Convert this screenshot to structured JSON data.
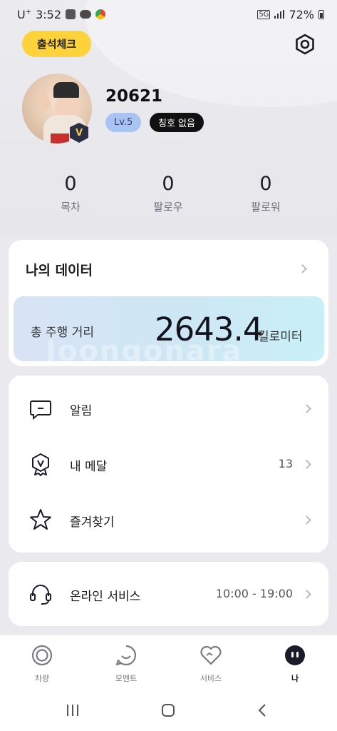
{
  "status_bar": {
    "carrier": "U",
    "carrier_sup": "+",
    "time": "3:52",
    "network": "5G",
    "battery": "72%",
    "icons": [
      "gallery-icon",
      "kakaotalk-icon",
      "chrome-icon"
    ]
  },
  "header": {
    "checkin_label": "출석체크",
    "settings_icon": "hexagon-gear-icon"
  },
  "profile": {
    "username": "20621",
    "level": "Lv.5",
    "title": "칭호 없음",
    "badge_letter": "V"
  },
  "stats": [
    {
      "value": "0",
      "label": "목차"
    },
    {
      "value": "0",
      "label": "팔로우"
    },
    {
      "value": "0",
      "label": "팔로워"
    }
  ],
  "my_data": {
    "title": "나의 데이터",
    "distance_label": "총 주행 거리",
    "distance_value": "2643.4",
    "distance_unit": "킬로미터",
    "watermark": "Joongonara"
  },
  "menu": [
    {
      "label": "알림",
      "icon": "message-icon",
      "value": ""
    },
    {
      "label": "내 메달",
      "icon": "medal-icon",
      "value": "13"
    },
    {
      "label": "즐겨찾기",
      "icon": "star-icon",
      "value": ""
    }
  ],
  "online_service": {
    "label": "온라인 서비스",
    "icon": "headset-icon",
    "hours": "10:00 - 19:00"
  },
  "bottom_nav": [
    {
      "label": "차량",
      "icon": "car-ring-icon",
      "active": false
    },
    {
      "label": "모멘트",
      "icon": "smile-bubble-icon",
      "active": false
    },
    {
      "label": "서비스",
      "icon": "heart-icon",
      "active": false
    },
    {
      "label": "나",
      "icon": "me-face-icon",
      "active": true
    }
  ],
  "colors": {
    "accent_yellow": "#fdd23a",
    "level_badge": "#a9c3f2",
    "title_badge": "#111111",
    "background": "#e9e9ee"
  }
}
